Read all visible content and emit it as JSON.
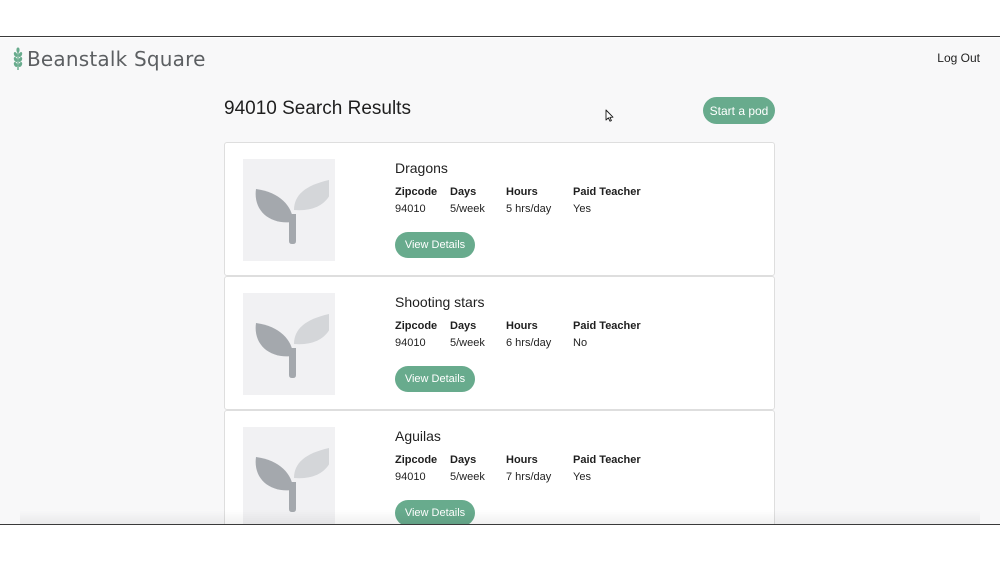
{
  "app": {
    "brand_name": "Beanstalk Square",
    "logout_label": "Log Out"
  },
  "page": {
    "title": "94010 Search Results",
    "start_pod_label": "Start a pod"
  },
  "columns": {
    "zipcode": "Zipcode",
    "days": "Days",
    "hours": "Hours",
    "paid_teacher": "Paid Teacher"
  },
  "pods": [
    {
      "name": "Dragons",
      "zipcode": "94010",
      "days": "5/week",
      "hours": "5 hrs/day",
      "paid_teacher": "Yes",
      "details_label": "View Details"
    },
    {
      "name": "Shooting stars",
      "zipcode": "94010",
      "days": "5/week",
      "hours": "6 hrs/day",
      "paid_teacher": "No",
      "details_label": "View Details"
    },
    {
      "name": "Aguilas",
      "zipcode": "94010",
      "days": "5/week",
      "hours": "7 hrs/day",
      "paid_teacher": "Yes",
      "details_label": "View Details"
    }
  ],
  "colors": {
    "accent": "#68ab8d",
    "brand_text": "#5c5f62",
    "placeholder_bg": "#f1f1f3",
    "sprout_dark": "#a4a8ad",
    "sprout_light": "#d4d6d9"
  },
  "icons": {
    "brand": "wheat-icon",
    "thumbnail": "sprout-icon",
    "cursor": "mouse-pointer-icon"
  }
}
